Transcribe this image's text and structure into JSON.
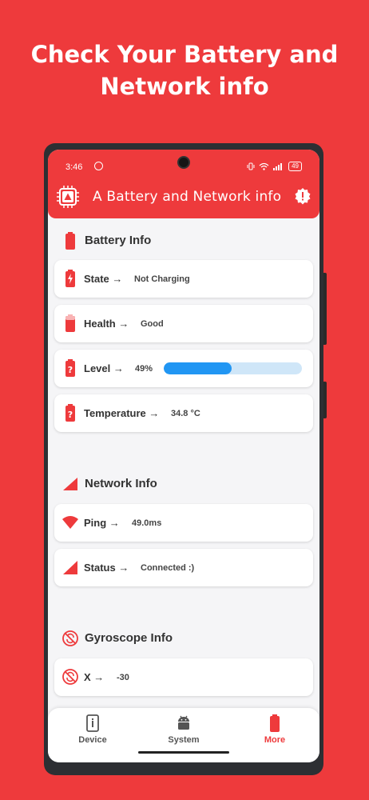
{
  "promo": {
    "line1": "Check Your Battery and",
    "line2": "Network info"
  },
  "status_bar": {
    "time": "3:46",
    "battery": "49"
  },
  "app_bar": {
    "title": "A Battery and Network info"
  },
  "battery_section": {
    "title": "Battery Info",
    "rows": [
      {
        "label": "State →",
        "value": "Not Charging"
      },
      {
        "label": "Health →",
        "value": "Good"
      },
      {
        "label": "Level →",
        "value": "49%",
        "progress": 0.49
      },
      {
        "label": "Temperature →",
        "value": "34.8 °C"
      }
    ]
  },
  "network_section": {
    "title": "Network Info",
    "rows": [
      {
        "label": "Ping →",
        "value": "49.0ms"
      },
      {
        "label": "Status →",
        "value": "Connected :)"
      }
    ]
  },
  "gyroscope_section": {
    "title": "Gyroscope Info",
    "rows": [
      {
        "label": "X →",
        "value": "-30"
      }
    ]
  },
  "bottom_nav": {
    "items": [
      {
        "label": "Device",
        "icon": "info-icon"
      },
      {
        "label": "System",
        "icon": "android-icon"
      },
      {
        "label": "More",
        "icon": "battery-icon",
        "active": true
      }
    ]
  },
  "colors": {
    "accent": "#ee3a3c",
    "progress": "#2196f3",
    "background": "#f5f5f7"
  }
}
